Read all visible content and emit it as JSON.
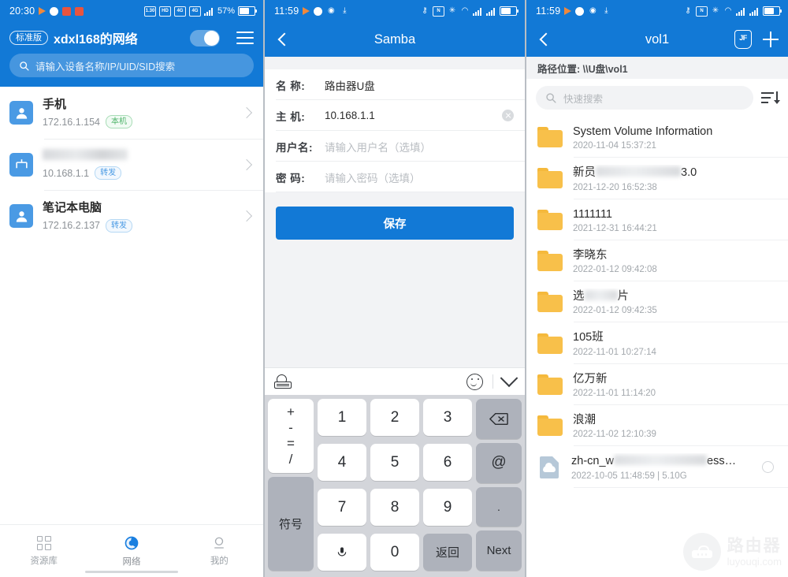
{
  "panel1": {
    "status": {
      "time": "20:30",
      "battery_pct": "57%",
      "net_label": "4G",
      "hd_label": "HD"
    },
    "header": {
      "version_badge": "标准版",
      "title": "xdxl168的网络",
      "toggle_on": true,
      "search_placeholder": "请输入设备名称/IP/UID/SID搜索"
    },
    "devices": [
      {
        "name": "手机",
        "ip": "172.16.1.154",
        "tag": "本机",
        "tag_color": "green",
        "icon": "person-icon",
        "blurred": false
      },
      {
        "name": "",
        "ip": "10.168.1.1",
        "tag": "转发",
        "tag_color": "blue",
        "icon": "router-icon",
        "blurred": true
      },
      {
        "name": "笔记本电脑",
        "ip": "172.16.2.137",
        "tag": "转发",
        "tag_color": "blue",
        "icon": "person-icon",
        "blurred": false
      }
    ],
    "tabs": [
      {
        "label": "资源库",
        "icon": "grid-icon",
        "active": false
      },
      {
        "label": "网络",
        "icon": "network-icon",
        "active": true
      },
      {
        "label": "我的",
        "icon": "profile-icon",
        "active": false
      }
    ]
  },
  "panel2": {
    "status": {
      "time": "11:59",
      "battery_pct": ""
    },
    "nav": {
      "title": "Samba",
      "back": "back-icon"
    },
    "form": [
      {
        "label": "名  称:",
        "value": "路由器U盘",
        "is_placeholder": false,
        "clearable": false
      },
      {
        "label": "主  机:",
        "value": "10.168.1.1",
        "is_placeholder": false,
        "clearable": true
      },
      {
        "label": "用户名:",
        "value": "请输入用户名（选填）",
        "is_placeholder": true,
        "clearable": false
      },
      {
        "label": "密  码:",
        "value": "请输入密码（选填）",
        "is_placeholder": true,
        "clearable": false
      }
    ],
    "save_label": "保存",
    "keyboard": {
      "toolbar": {
        "globe": "keyboard-language-icon",
        "emoji": "emoji-icon",
        "collapse": "chevron-down-icon"
      },
      "symbol_col": [
        "+",
        "-",
        "=",
        "/"
      ],
      "digits_rows": [
        [
          "1",
          "2",
          "3"
        ],
        [
          "4",
          "5",
          "6"
        ],
        [
          "7",
          "8",
          "9"
        ]
      ],
      "right_col": [
        "backspace-icon",
        "@",
        "."
      ],
      "bottom": {
        "symbols": "符号",
        "space": "space-mic-icon",
        "zero": "0",
        "enter": "返回",
        "next": "Next"
      }
    }
  },
  "panel3": {
    "status": {
      "time": "11:59"
    },
    "nav": {
      "title": "vol1",
      "back": "back-icon",
      "shield_label": "JF",
      "add": "plus-icon"
    },
    "path": {
      "label": "路径位置:",
      "value": "\\\\U盘\\vol1"
    },
    "search_placeholder": "快速搜索",
    "sort_icon": "sort-descending-icon",
    "files": [
      {
        "name": "System Volume Information",
        "meta": "2020-11-04 15:37:21",
        "type": "folder",
        "blur": null,
        "size": ""
      },
      {
        "name": "新员",
        "name_tail": "3.0",
        "meta": "2021-12-20 16:52:38",
        "type": "folder",
        "blur": "mid",
        "size": ""
      },
      {
        "name": "1111111",
        "meta": "2021-12-31 16:44:21",
        "type": "folder",
        "blur": null,
        "size": ""
      },
      {
        "name": "李晓东",
        "meta": "2022-01-12 09:42:08",
        "type": "folder",
        "blur": null,
        "size": ""
      },
      {
        "name": "选",
        "name_tail": "片",
        "meta": "2022-01-12 09:42:35",
        "type": "folder",
        "blur": "mid",
        "size": ""
      },
      {
        "name": "105班",
        "meta": "2022-11-01 10:27:14",
        "type": "folder",
        "blur": null,
        "size": ""
      },
      {
        "name": "亿万新",
        "meta": "2022-11-01 11:14:20",
        "type": "folder",
        "blur": null,
        "size": ""
      },
      {
        "name": "浪潮",
        "meta": "2022-11-02 12:10:39",
        "type": "folder",
        "blur": null,
        "size": ""
      },
      {
        "name": "zh-cn_w",
        "name_tail": "ess…",
        "meta": "2022-10-05 11:48:59  |  5.10G",
        "type": "file",
        "blur": "mid",
        "size": "5.10G"
      }
    ],
    "watermark": {
      "cn": "路由器",
      "en": "luyouqi.com"
    }
  }
}
